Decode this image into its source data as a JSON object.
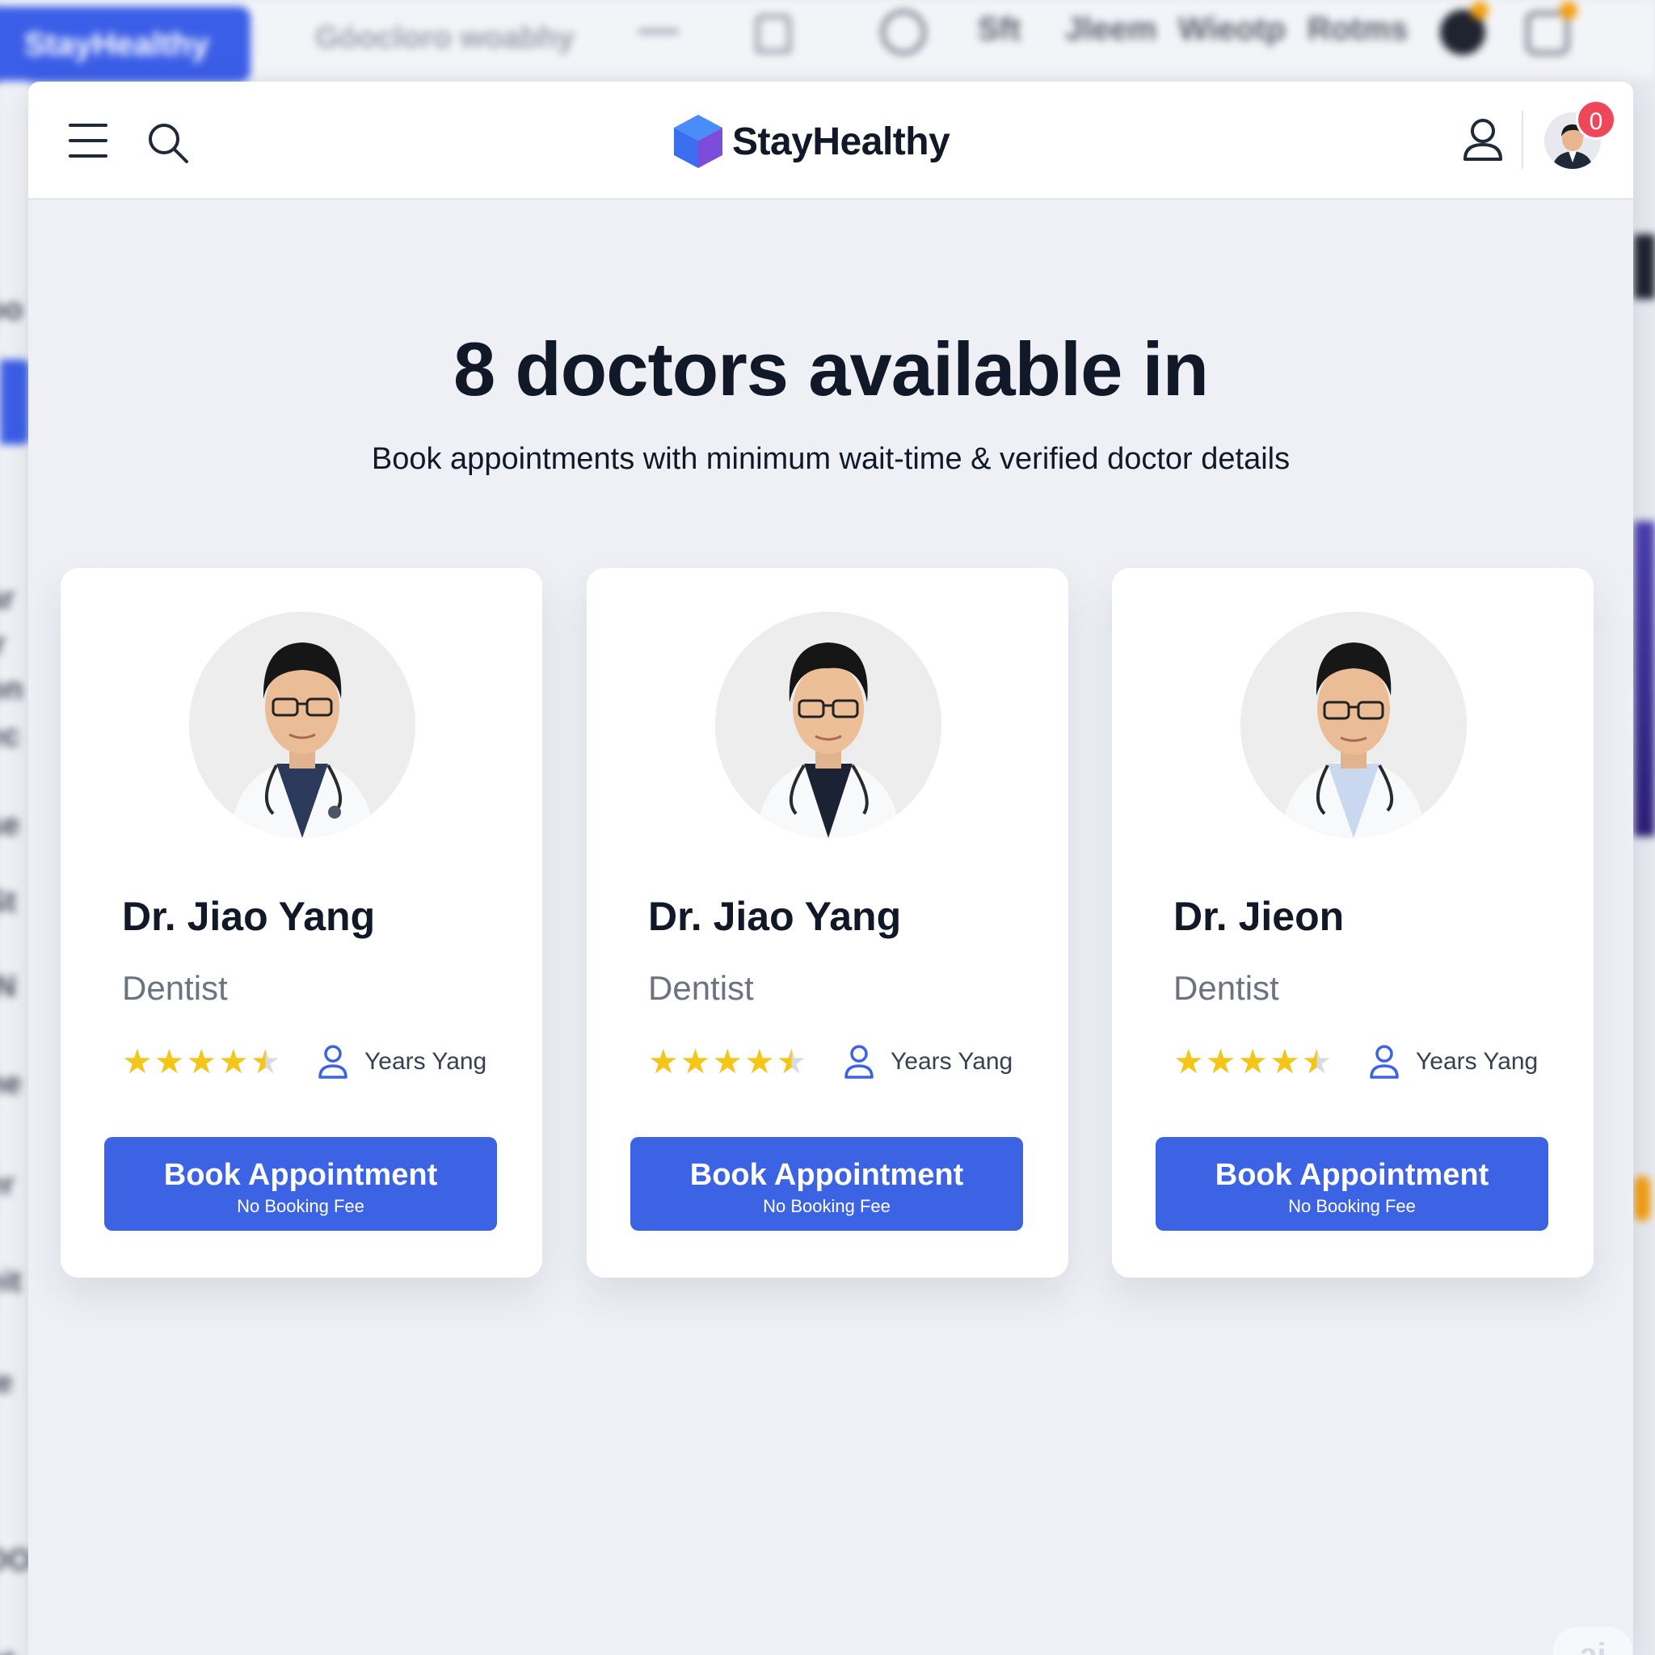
{
  "app": {
    "brand": "StayHealthy"
  },
  "background": {
    "brand_label": "StayHealthy",
    "search_text": "Góocloro woabhy",
    "menu": [
      "Sft",
      "Jleem",
      "Wieotp",
      "Rotms"
    ],
    "sidebar_words": [
      "oo",
      "ar",
      "ir",
      "on",
      "ec",
      "se",
      "St",
      "IN",
      "he",
      "er",
      "eit",
      "te",
      "DO",
      "ot"
    ]
  },
  "header": {
    "menu_icon": "hamburger-icon",
    "search_icon": "search-icon",
    "logo_icon": "cube-logo-icon",
    "brand": "StayHealthy",
    "user_icon": "user-icon",
    "notification_count": "0"
  },
  "hero": {
    "title": "8 doctors available in",
    "subtitle": "Book appointments with minimum wait-time & verified doctor details"
  },
  "doctors": [
    {
      "name": "Dr. Jiao Yang",
      "specialty": "Dentist",
      "rating": 4.5,
      "experience": "Years Yang",
      "book_label": "Book Appointment",
      "fee_label": "No Booking Fee"
    },
    {
      "name": "Dr. Jiao Yang",
      "specialty": "Dentist",
      "rating": 4.5,
      "experience": "Years Yang",
      "book_label": "Book Appointment",
      "fee_label": "No Booking Fee"
    },
    {
      "name": "Dr. Jieon",
      "specialty": "Dentist",
      "rating": 4.5,
      "experience": "Years Yang",
      "book_label": "Book Appointment",
      "fee_label": "No Booking Fee"
    }
  ],
  "colors": {
    "accent": "#3c63e3",
    "star": "#f5c518",
    "badge": "#f0465a"
  },
  "watermark": "ai"
}
